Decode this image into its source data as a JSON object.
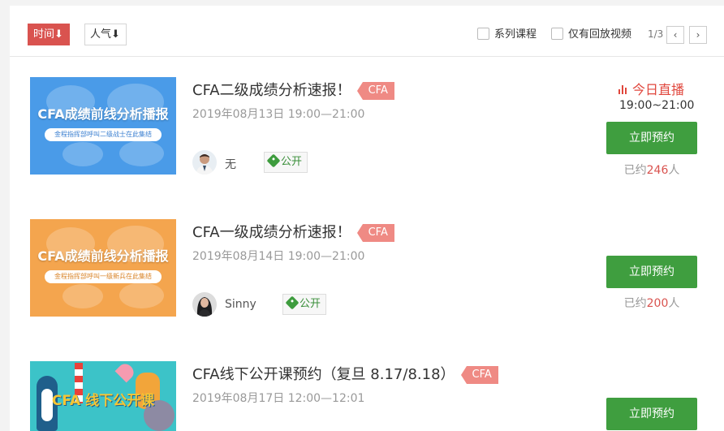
{
  "toolbar": {
    "sort_time": "时间⬇",
    "sort_popularity": "人气⬇",
    "filter_series": "系列课程",
    "filter_replay": "仅有回放视频",
    "page_indicator": "1/3",
    "prev": "‹",
    "next": "›"
  },
  "courses": [
    {
      "title": "CFA二级成绩分析速报！",
      "tag": "CFA",
      "date": "2019年08月13日 19:00—21:00",
      "teacher": "无",
      "access": "公开",
      "thumb_title": "CFA成绩前线分析播报",
      "thumb_subtitle": "金程指挥部呼叫二级战士在此集结",
      "thumb_color": "#4a9be8",
      "live_label": "今日直播",
      "live_time": "19:00~21:00",
      "book_label": "立即预约",
      "booked_prefix": "已约",
      "booked_count": "246",
      "booked_suffix": "人"
    },
    {
      "title": "CFA一级成绩分析速报！",
      "tag": "CFA",
      "date": "2019年08月14日 19:00—21:00",
      "teacher": "Sinny",
      "access": "公开",
      "thumb_title": "CFA成绩前线分析播报",
      "thumb_subtitle": "金程指挥部呼叫一级新兵在此集结",
      "thumb_color": "#f4a54e",
      "book_label": "立即预约",
      "booked_prefix": "已约",
      "booked_count": "200",
      "booked_suffix": "人"
    },
    {
      "title": "CFA线下公开课预约（复旦 8.17/8.18）",
      "tag": "CFA",
      "date": "2019年08月17日 12:00—12:01",
      "thumb_title": "CFA 线下公开课",
      "thumb_color": "#3cc3c8",
      "book_label": "立即预约"
    }
  ],
  "colors": {
    "accent_red": "#d9534f",
    "book_green": "#3f9e3f",
    "tag_pink": "#ef8a84",
    "live_red": "#e0463c"
  }
}
